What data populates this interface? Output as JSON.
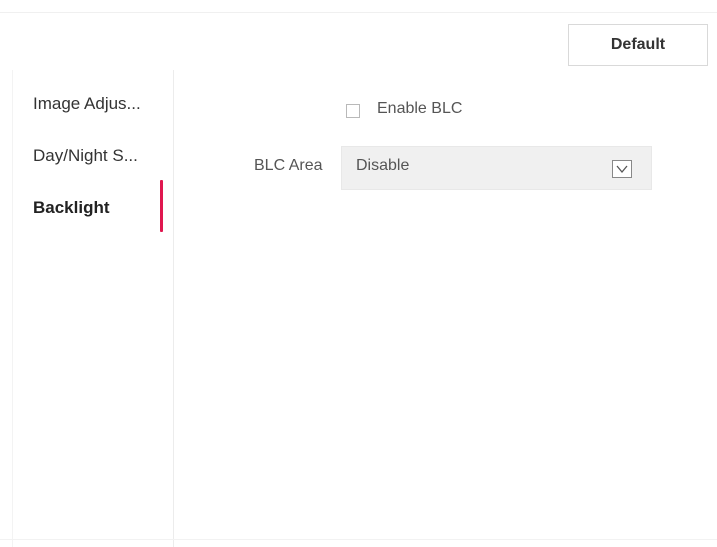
{
  "toolbar": {
    "default_label": "Default"
  },
  "sidebar": {
    "items": [
      {
        "label": "Image Adjus..."
      },
      {
        "label": "Day/Night S..."
      },
      {
        "label": "Backlight"
      }
    ],
    "accent_color": "#e0174f"
  },
  "blc": {
    "enable_label": "Enable BLC",
    "enable_checked": false,
    "area_label": "BLC Area",
    "area_value": "Disable"
  },
  "icons": {
    "select_arrow": "chevron-down-icon"
  }
}
